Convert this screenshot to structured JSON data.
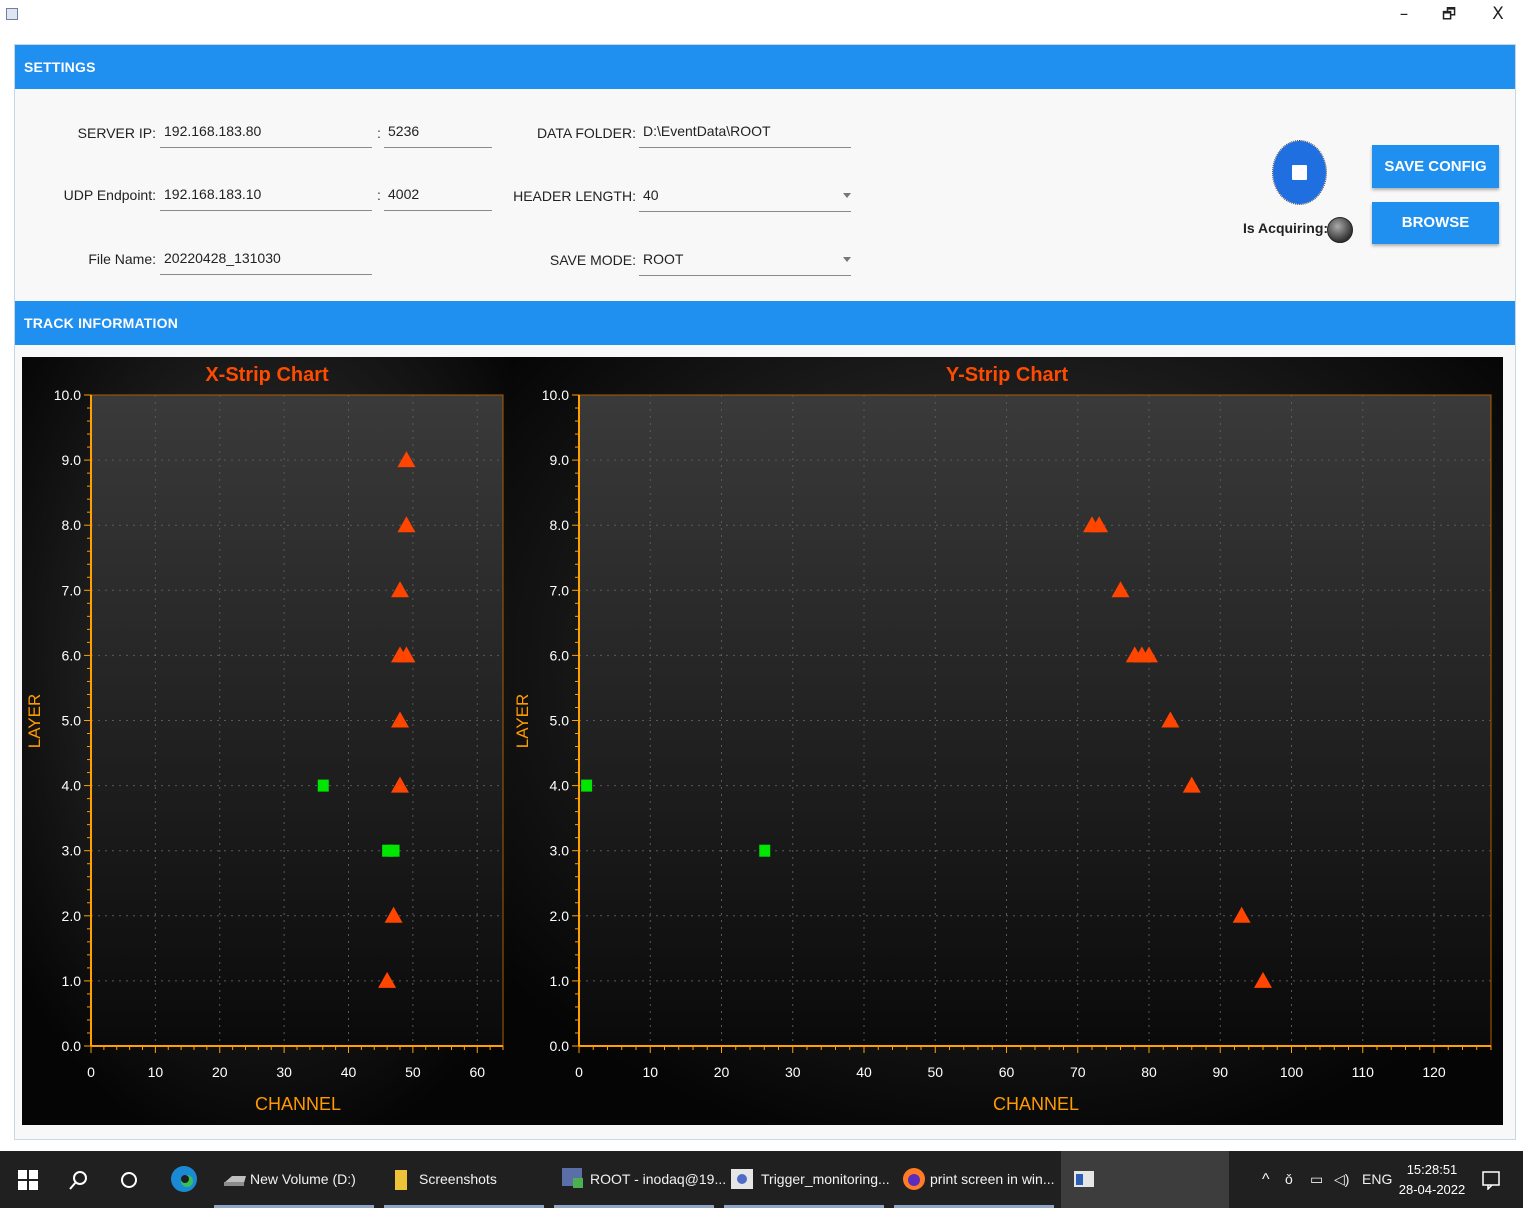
{
  "window": {
    "minimize": "–",
    "restore": "🗗",
    "close": "X"
  },
  "settings": {
    "title": "SETTINGS",
    "server_ip_label": "SERVER IP:",
    "server_ip": "192.168.183.80",
    "server_port": "5236",
    "udp_label": "UDP Endpoint:",
    "udp_ip": "192.168.183.10",
    "udp_port": "4002",
    "file_label": "File Name:",
    "file_name": "20220428_131030",
    "folder_label": "DATA FOLDER:",
    "folder": "D:\\EventData\\ROOT",
    "header_label": "HEADER LENGTH:",
    "header": "40",
    "mode_label": "SAVE MODE:",
    "mode": "ROOT",
    "colon": ":",
    "save_config": "SAVE CONFIG",
    "browse": "BROWSE",
    "is_acquiring": "Is Acquiring:"
  },
  "track": {
    "title": "TRACK INFORMATION"
  },
  "chart_data": [
    {
      "type": "scatter",
      "title": "X-Strip Chart",
      "xlabel": "CHANNEL",
      "ylabel": "LAYER",
      "xlim": [
        0,
        64
      ],
      "ylim": [
        0,
        10
      ],
      "xticks": [
        0,
        10,
        20,
        30,
        40,
        50,
        60
      ],
      "yticks": [
        0,
        1,
        2,
        3,
        4,
        5,
        6,
        7,
        8,
        9,
        10
      ],
      "ytick_labels": [
        "0.0",
        "1.0",
        "2.0",
        "3.0",
        "4.0",
        "5.0",
        "6.0",
        "7.0",
        "8.0",
        "9.0",
        "10.0"
      ],
      "grid": true,
      "series": [
        {
          "marker": "triangle",
          "color": "#ff4500",
          "points": [
            [
              49,
              9
            ],
            [
              49,
              8
            ],
            [
              48,
              7
            ],
            [
              48,
              6
            ],
            [
              49,
              6
            ],
            [
              48,
              5
            ],
            [
              48,
              4
            ],
            [
              47,
              2
            ],
            [
              46,
              1
            ]
          ]
        },
        {
          "marker": "square",
          "color": "#00e600",
          "points": [
            [
              36,
              4
            ],
            [
              46,
              3
            ],
            [
              47,
              3
            ]
          ]
        }
      ]
    },
    {
      "type": "scatter",
      "title": "Y-Strip Chart",
      "xlabel": "CHANNEL",
      "ylabel": "LAYER",
      "xlim": [
        0,
        128
      ],
      "ylim": [
        0,
        10
      ],
      "xticks": [
        0,
        10,
        20,
        30,
        40,
        50,
        60,
        70,
        80,
        90,
        100,
        110,
        120
      ],
      "yticks": [
        0,
        1,
        2,
        3,
        4,
        5,
        6,
        7,
        8,
        9,
        10
      ],
      "ytick_labels": [
        "0.0",
        "1.0",
        "2.0",
        "3.0",
        "4.0",
        "5.0",
        "6.0",
        "7.0",
        "8.0",
        "9.0",
        "10.0"
      ],
      "grid": true,
      "series": [
        {
          "marker": "triangle",
          "color": "#ff4500",
          "points": [
            [
              72,
              8
            ],
            [
              73,
              8
            ],
            [
              76,
              7
            ],
            [
              78,
              6
            ],
            [
              79,
              6
            ],
            [
              80,
              6
            ],
            [
              83,
              5
            ],
            [
              86,
              4
            ],
            [
              93,
              2
            ],
            [
              96,
              1
            ]
          ]
        },
        {
          "marker": "square",
          "color": "#00e600",
          "points": [
            [
              1,
              4
            ],
            [
              26,
              3
            ]
          ]
        }
      ]
    }
  ],
  "taskbar": {
    "items": [
      {
        "label": "New Volume (D:)",
        "icon": "drive-icon"
      },
      {
        "label": "Screenshots",
        "icon": "folder-icon"
      },
      {
        "label": "ROOT - inodaq@19...",
        "icon": "terminal-icon"
      },
      {
        "label": "Trigger_monitoring...",
        "icon": "app-icon"
      },
      {
        "label": "print screen in win...",
        "icon": "firefox-icon"
      }
    ],
    "lang": "ENG",
    "time": "15:28:51",
    "date": "28-04-2022"
  }
}
